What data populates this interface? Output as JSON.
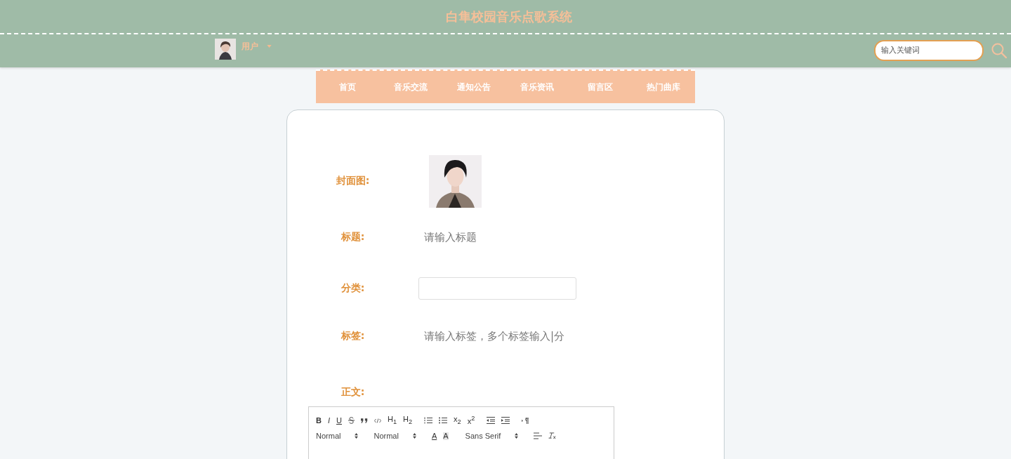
{
  "header": {
    "title": "白隼校园音乐点歌系统",
    "user": {
      "name": "用户"
    },
    "search": {
      "placeholder": "输入关键词"
    }
  },
  "nav": [
    {
      "label": "首页",
      "selected": false
    },
    {
      "label": "音乐交流",
      "selected": false
    },
    {
      "label": "通知公告",
      "selected": false
    },
    {
      "label": "音乐资讯",
      "selected": false
    },
    {
      "label": "留言区",
      "selected": false
    },
    {
      "label": "热门曲库",
      "selected": false
    }
  ],
  "form": {
    "cover": {
      "label": "封面图:",
      "kind": "picture"
    },
    "title": {
      "label": "标题:",
      "placeholder": "请输入标题"
    },
    "category": {
      "label": "分类:"
    },
    "tags": {
      "label": "标签:",
      "placeholder": "请输入标签，多个标签输入|分"
    },
    "body": {
      "label": "正文:"
    }
  },
  "toolbar": [
    [
      {
        "kind": "bold",
        "label": "B"
      },
      {
        "kind": "italic",
        "label": "I"
      },
      {
        "kind": "underline",
        "label": "U"
      },
      {
        "kind": "strike"
      },
      {
        "kind": "quote"
      },
      {
        "kind": "code"
      },
      {
        "kind": "text",
        "label": "H$_{1}$"
      },
      {
        "kind": "text",
        "label": "H$_{2}$"
      },
      {
        "kind": "ordered-list"
      },
      {
        "kind": "bullet-list"
      },
      {
        "kind": "text",
        "label": "x$_{2}$"
      },
      {
        "kind": "text",
        "label": "x$^{2}$"
      },
      {
        "kind": "outdent"
      },
      {
        "kind": "indent"
      },
      {
        "kind": "direction"
      }
    ],
    [
      {
        "kind": "select",
        "label": "Normal"
      },
      {
        "kind": "select",
        "label": "Normal"
      },
      {
        "kind": "color",
        "label": "A"
      },
      {
        "kind": "background",
        "label": "A"
      },
      {
        "kind": "select",
        "label": "Sans Serif"
      },
      {
        "kind": "align"
      },
      {
        "kind": "clean"
      }
    ]
  ]
}
